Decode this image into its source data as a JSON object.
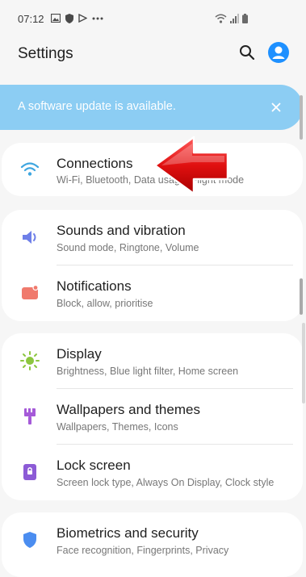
{
  "status_bar": {
    "time": "07:12",
    "left_icons": [
      "image-icon",
      "shield-icon",
      "play-icon",
      "more-icon"
    ],
    "right_icons": [
      "wifi-icon",
      "signal-icon",
      "battery-icon"
    ]
  },
  "header": {
    "title": "Settings",
    "search_icon": "search-icon",
    "profile_icon": "profile-icon",
    "accent_color": "#1e90ff"
  },
  "banner": {
    "text": "A software update is available.",
    "close_icon": "close-icon",
    "background_color": "#8ccdf3"
  },
  "items": [
    {
      "title": "Connections",
      "subtitle": "Wi-Fi, Bluetooth, Data usage, Flight mode",
      "icon": "wifi-icon",
      "color": "#3fa6e0"
    },
    {
      "title": "Sounds and vibration",
      "subtitle": "Sound mode, Ringtone, Volume",
      "icon": "speaker-icon",
      "color": "#6e7fe8"
    },
    {
      "title": "Notifications",
      "subtitle": "Block, allow, prioritise",
      "icon": "notification-icon",
      "color": "#f07a6d"
    },
    {
      "title": "Display",
      "subtitle": "Brightness, Blue light filter, Home screen",
      "icon": "brightness-icon",
      "color": "#8cc63f"
    },
    {
      "title": "Wallpapers and themes",
      "subtitle": "Wallpapers, Themes, Icons",
      "icon": "brush-icon",
      "color": "#a55ad8"
    },
    {
      "title": "Lock screen",
      "subtitle": "Screen lock type, Always On Display, Clock style",
      "icon": "lock-icon",
      "color": "#8c5bd6"
    },
    {
      "title": "Biometrics and security",
      "subtitle": "Face recognition, Fingerprints, Privacy",
      "icon": "shield-icon",
      "color": "#4b8df0"
    }
  ],
  "annotation": {
    "arrow_color": "#e01010",
    "icon": "arrow-left-icon"
  }
}
